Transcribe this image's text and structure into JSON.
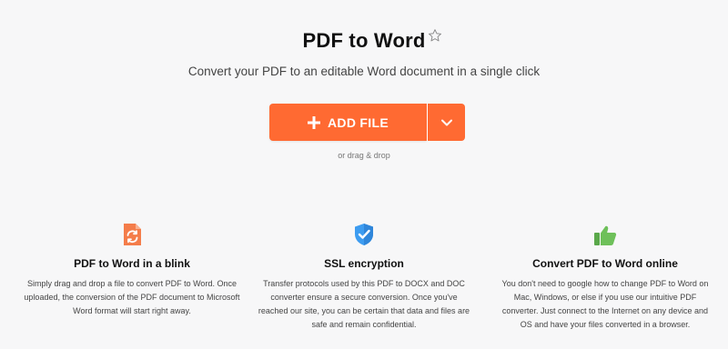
{
  "header": {
    "title": "PDF to Word",
    "subtitle": "Convert your PDF to an editable Word document in a single click"
  },
  "upload": {
    "add_label": "ADD FILE",
    "drag_text": "or drag & drop"
  },
  "features": [
    {
      "icon": "refresh-file-icon",
      "title": "PDF to Word in a blink",
      "text": "Simply drag and drop a file to convert PDF to Word. Once uploaded, the conversion of the PDF document to Microsoft Word format will start right away."
    },
    {
      "icon": "shield-check-icon",
      "title": "SSL encryption",
      "text": "Transfer protocols used by this PDF to DOCX and DOC converter ensure a secure conversion. Once you've reached our site, you can be certain that data and files are safe and remain confidential."
    },
    {
      "icon": "thumbs-up-icon",
      "title": "Convert PDF to Word online",
      "text": "You don't need to google how to change PDF to Word on Mac, Windows, or else if you use our intuitive PDF converter. Just connect to the Internet on any device and OS and have your files converted in a browser."
    }
  ],
  "colors": {
    "accent": "#ff6a32",
    "shield": "#3d9cf0",
    "thumb": "#6ec05a",
    "background": "#f7f7f8"
  }
}
